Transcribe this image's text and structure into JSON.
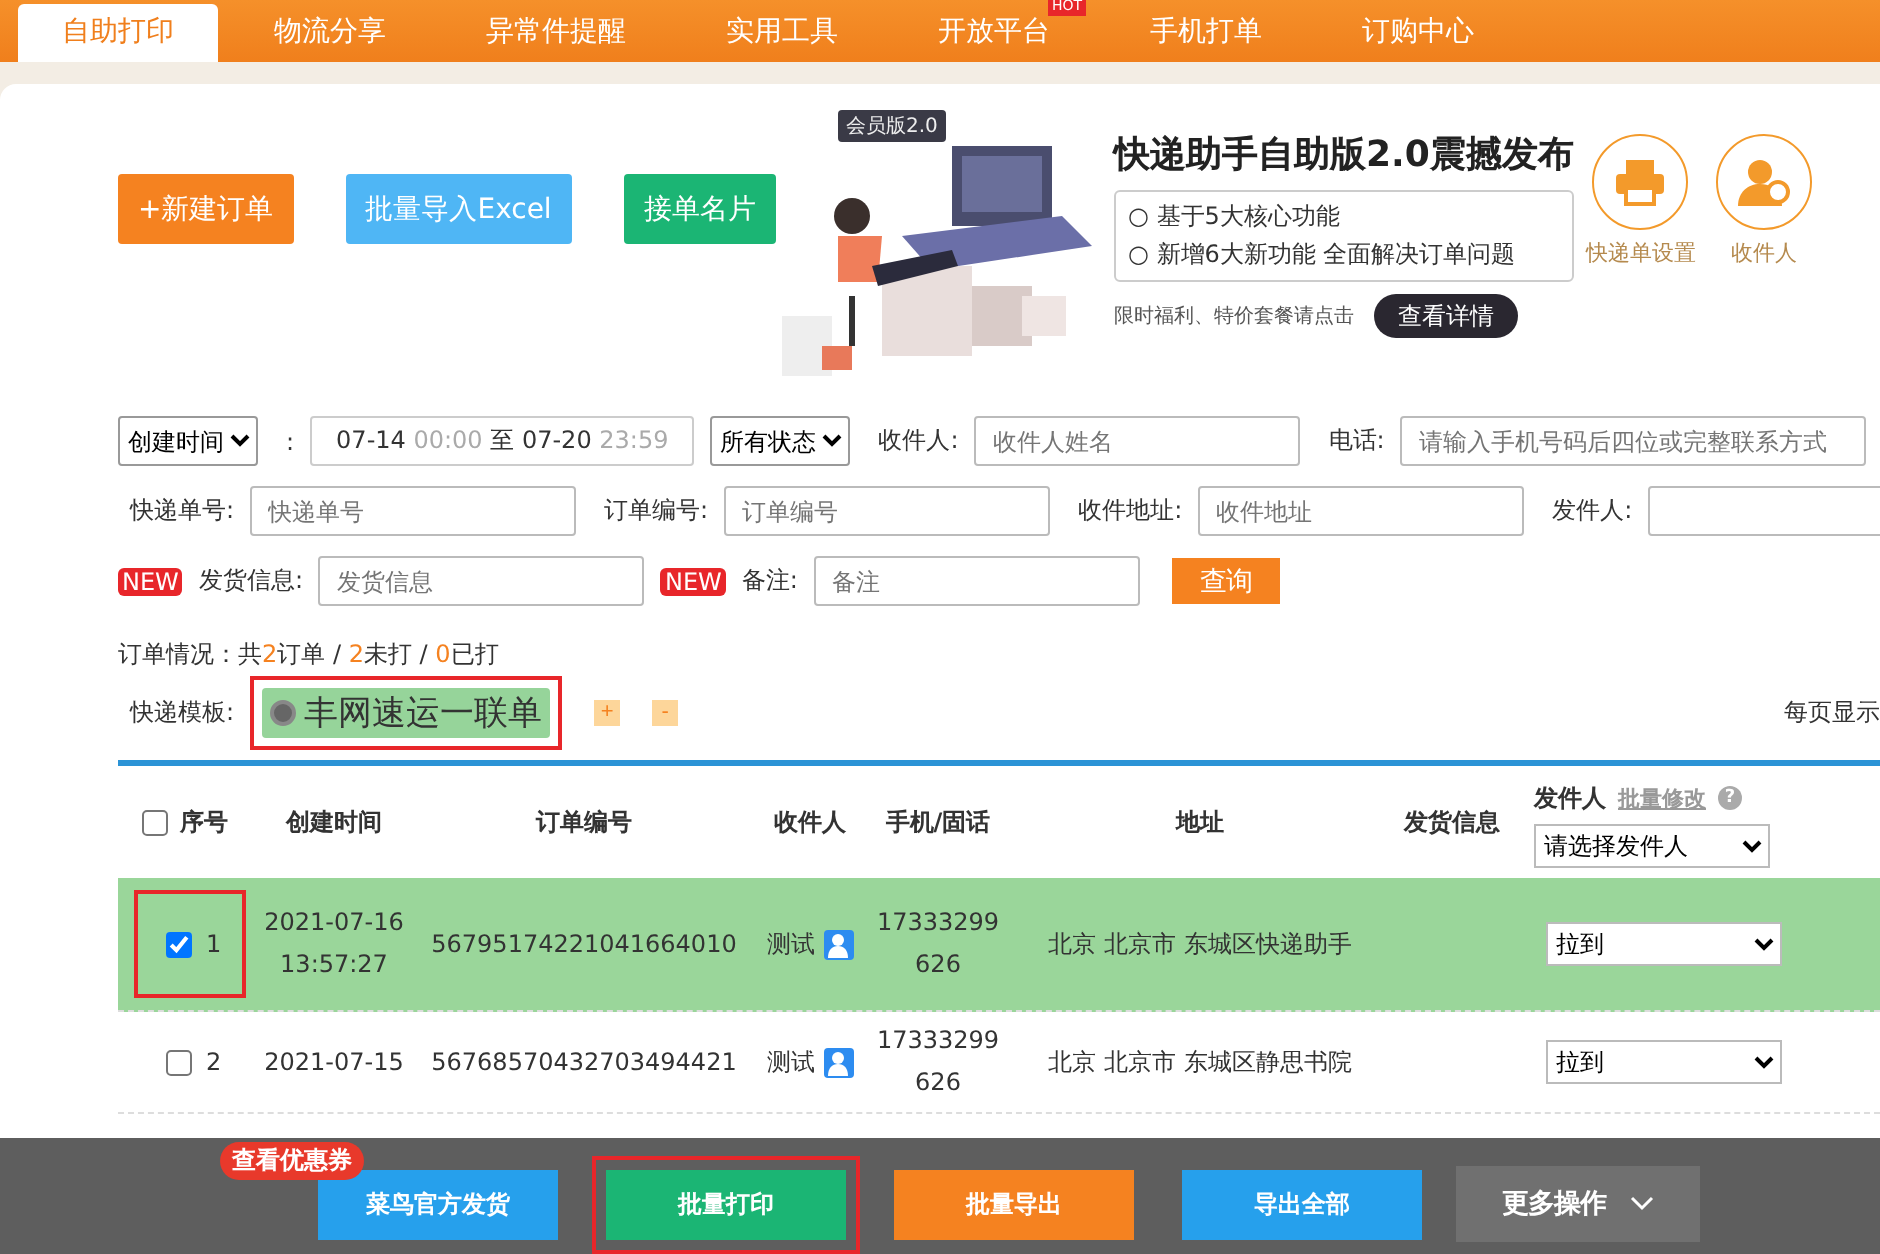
{
  "nav": {
    "tabs": [
      {
        "label": "自助打印",
        "selected": true
      },
      {
        "label": "物流分享",
        "selected": false
      },
      {
        "label": "异常件提醒",
        "selected": false
      },
      {
        "label": "实用工具",
        "selected": false
      },
      {
        "label": "开放平台",
        "selected": false,
        "badge": "HOT"
      },
      {
        "label": "手机打单",
        "selected": false
      },
      {
        "label": "订购中心",
        "selected": false
      }
    ]
  },
  "actions": [
    {
      "label": "+新建订单",
      "kind": "orange"
    },
    {
      "label": "批量导入Excel",
      "kind": "sky"
    },
    {
      "label": "接单名片",
      "kind": "green"
    }
  ],
  "banner": {
    "badge": "会员版2.0",
    "title": "快递助手自助版2.0震撼发布",
    "bullets": [
      "○ 基于5大核心功能",
      "○ 新增6大新功能 全面解决订单问题"
    ],
    "note": "限时福利、特价套餐请点击",
    "button": "查看详情"
  },
  "shortcuts": [
    {
      "label": "快递单设置",
      "kind": "printer"
    },
    {
      "label": "收件人",
      "kind": "person"
    }
  ],
  "filters": {
    "date_type": "创建时间",
    "colon": ":",
    "start_date": "07-14",
    "start_time": "00:00",
    "separator": "至",
    "end_date": "07-20",
    "end_time": "23:59",
    "status": "所有状态",
    "receiver": {
      "label": "收件人:",
      "placeholder": "收件人姓名"
    },
    "phone": {
      "label": "电话:",
      "placeholder": "请输入手机号码后四位或完整联系方式"
    },
    "tracking_no": {
      "label": "快递单号:",
      "placeholder": "快递单号"
    },
    "order_no": {
      "label": "订单编号:",
      "placeholder": "订单编号"
    },
    "address": {
      "label": "收件地址:",
      "placeholder": "收件地址"
    },
    "sender": {
      "label": "发件人:"
    },
    "shipping_info": {
      "badge": "NEW",
      "label": "发货信息:",
      "placeholder": "发货信息"
    },
    "remark": {
      "badge": "NEW",
      "label": "备注:",
      "placeholder": "备注"
    },
    "query": "查询"
  },
  "order_summary": [
    {
      "text": "订单情况：共",
      "highlight": false
    },
    {
      "text": "2",
      "highlight": true
    },
    {
      "text": "订单 / ",
      "highlight": false
    },
    {
      "text": "2",
      "highlight": true
    },
    {
      "text": "未打 / ",
      "highlight": false
    },
    {
      "text": "0",
      "highlight": true
    },
    {
      "text": "已打",
      "highlight": false
    }
  ],
  "template": {
    "label": "快递模板:",
    "items": [
      {
        "name": "丰网速运一联单",
        "selected": true,
        "highlighted": true
      }
    ],
    "add": "+",
    "remove": "-",
    "per_page": "每页显示"
  },
  "table": {
    "select_all": false,
    "columns": [
      "序号",
      "创建时间",
      "订单编号",
      "收件人",
      "手机/固话",
      "地址",
      "发货信息",
      "发件人"
    ],
    "bulk_edit": "批量修改",
    "help": "?",
    "sender_select": "请选择发件人",
    "rows": [
      {
        "selected": true,
        "highlighted": true,
        "index": "1",
        "date": "2021-07-16",
        "time": "13:57:27",
        "order_no": "56795174221041664010",
        "receiver": "测试",
        "phone": [
          "17333299",
          "626"
        ],
        "address": "北京 北京市 东城区快递助手",
        "sender": "拉到"
      },
      {
        "selected": false,
        "highlighted": false,
        "index": "2",
        "date": "2021-07-15",
        "order_no": "56768570432703494421",
        "receiver": "测试",
        "phone": [
          "17333299",
          "626"
        ],
        "address": "北京 北京市 东城区静思书院",
        "sender": "拉到"
      }
    ]
  },
  "bottom_bar": {
    "coupon": "查看优惠券",
    "buttons": [
      {
        "label": "菜鸟官方发货",
        "kind": "blue",
        "highlighted": false
      },
      {
        "label": "批量打印",
        "kind": "green",
        "highlighted": true
      },
      {
        "label": "批量导出",
        "kind": "orange",
        "highlighted": false
      },
      {
        "label": "导出全部",
        "kind": "blue",
        "highlighted": false
      }
    ],
    "more": "更多操作"
  }
}
